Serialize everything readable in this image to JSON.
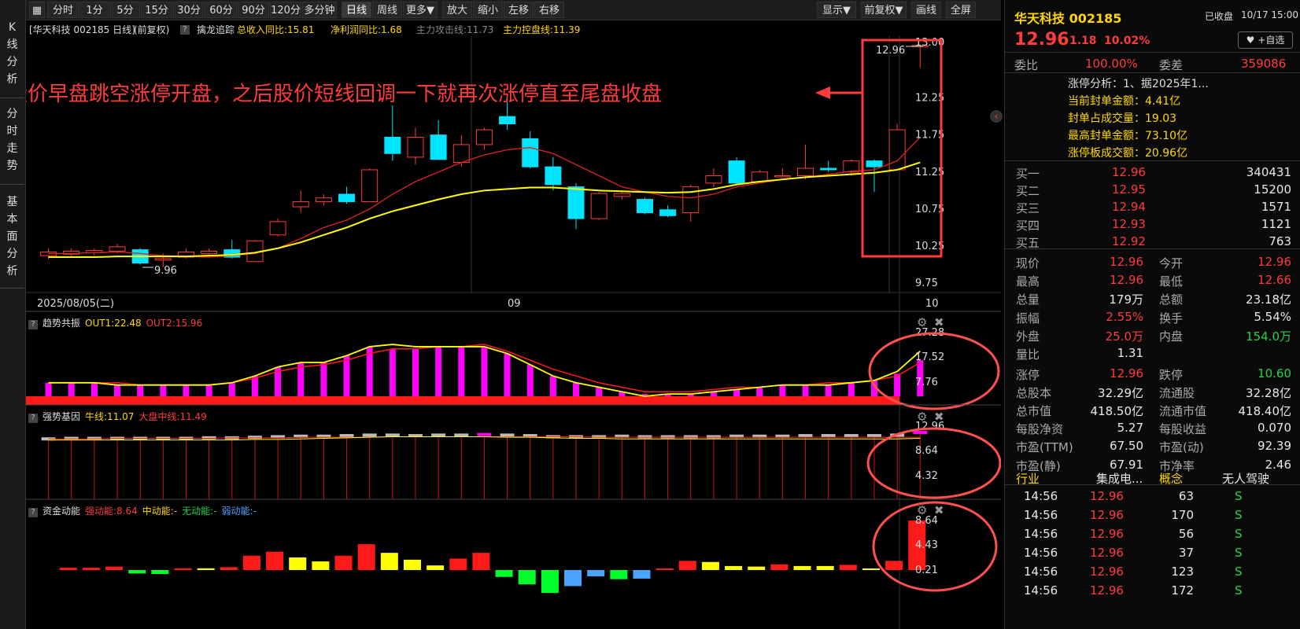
{
  "leftbar": {
    "tabs": [
      "K\n线\n分\n析",
      "分\n时\n走\n势",
      "基\n本\n面\n分\n析"
    ]
  },
  "toolbar": {
    "buttons": [
      "分时",
      "1分",
      "5分",
      "15分",
      "30分",
      "60分",
      "90分",
      "120分",
      "多分钟",
      "日线",
      "周线",
      "更多▼",
      "放大",
      "缩小",
      "左移",
      "右移"
    ],
    "right_buttons": [
      "显示▼",
      "前复权▼",
      "画线",
      "全屏"
    ],
    "active": "日线"
  },
  "infobar": {
    "title": "[华天科技 002185 日线]",
    "adjust": "(前复权)",
    "indicator": "擒龙追踪",
    "revenue": "总收入同比:15.81",
    "profit": "净利润同比:1.68",
    "attack": "主力攻击线:11.73",
    "control": "主力控盘线:11.39"
  },
  "chart": {
    "annotation": "股价早盘跳空涨停开盘，之后股价短线回调一下就再次涨停直至尾盘收盘",
    "high_label": "12.96",
    "low_label": "9.96",
    "date_label": "2025/08/05(二)",
    "month_labels": [
      "09",
      "10"
    ],
    "price_ticks": [
      "13.00",
      "12.25",
      "11.75",
      "11.25",
      "10.75",
      "10.25",
      "9.75"
    ]
  },
  "chart_data": [
    {
      "type": "candlestick",
      "candles": [
        {
          "o": 10.12,
          "h": 10.22,
          "l": 10.07,
          "c": 10.17
        },
        {
          "o": 10.14,
          "h": 10.22,
          "l": 10.1,
          "c": 10.18
        },
        {
          "o": 10.16,
          "h": 10.22,
          "l": 10.12,
          "c": 10.19
        },
        {
          "o": 10.18,
          "h": 10.28,
          "l": 10.15,
          "c": 10.24
        },
        {
          "o": 10.2,
          "h": 10.22,
          "l": 10.0,
          "c": 10.02
        },
        {
          "o": 10.06,
          "h": 10.15,
          "l": 9.96,
          "c": 10.08
        },
        {
          "o": 10.1,
          "h": 10.22,
          "l": 10.08,
          "c": 10.17
        },
        {
          "o": 10.15,
          "h": 10.22,
          "l": 10.12,
          "c": 10.18
        },
        {
          "o": 10.2,
          "h": 10.33,
          "l": 10.08,
          "c": 10.1
        },
        {
          "o": 10.04,
          "h": 10.33,
          "l": 10.04,
          "c": 10.32
        },
        {
          "o": 10.4,
          "h": 10.62,
          "l": 10.38,
          "c": 10.58
        },
        {
          "o": 10.78,
          "h": 11.0,
          "l": 10.7,
          "c": 10.85
        },
        {
          "o": 10.85,
          "h": 10.95,
          "l": 10.8,
          "c": 10.9
        },
        {
          "o": 10.95,
          "h": 11.05,
          "l": 10.82,
          "c": 10.85
        },
        {
          "o": 10.85,
          "h": 11.3,
          "l": 10.85,
          "c": 11.28
        },
        {
          "o": 11.72,
          "h": 12.15,
          "l": 11.4,
          "c": 11.5
        },
        {
          "o": 11.45,
          "h": 11.85,
          "l": 11.35,
          "c": 11.72
        },
        {
          "o": 11.75,
          "h": 11.95,
          "l": 11.42,
          "c": 11.42
        },
        {
          "o": 11.38,
          "h": 11.75,
          "l": 11.32,
          "c": 11.62
        },
        {
          "o": 11.62,
          "h": 11.85,
          "l": 11.55,
          "c": 11.82
        },
        {
          "o": 12.0,
          "h": 12.2,
          "l": 11.82,
          "c": 11.9
        },
        {
          "o": 11.7,
          "h": 11.8,
          "l": 11.3,
          "c": 11.32
        },
        {
          "o": 11.32,
          "h": 11.45,
          "l": 11.0,
          "c": 11.08
        },
        {
          "o": 11.05,
          "h": 11.1,
          "l": 10.48,
          "c": 10.62
        },
        {
          "o": 10.62,
          "h": 10.98,
          "l": 10.6,
          "c": 10.96
        },
        {
          "o": 10.92,
          "h": 11.0,
          "l": 10.88,
          "c": 10.96
        },
        {
          "o": 10.88,
          "h": 10.9,
          "l": 10.68,
          "c": 10.7
        },
        {
          "o": 10.74,
          "h": 10.8,
          "l": 10.64,
          "c": 10.66
        },
        {
          "o": 10.7,
          "h": 11.08,
          "l": 10.58,
          "c": 11.05
        },
        {
          "o": 11.1,
          "h": 11.3,
          "l": 11.05,
          "c": 11.2
        },
        {
          "o": 11.4,
          "h": 11.45,
          "l": 11.08,
          "c": 11.1
        },
        {
          "o": 11.12,
          "h": 11.28,
          "l": 11.1,
          "c": 11.25
        },
        {
          "o": 11.2,
          "h": 11.3,
          "l": 11.18,
          "c": 11.2
        },
        {
          "o": 11.2,
          "h": 11.62,
          "l": 11.15,
          "c": 11.3
        },
        {
          "o": 11.3,
          "h": 11.4,
          "l": 11.25,
          "c": 11.28
        },
        {
          "o": 11.25,
          "h": 11.42,
          "l": 11.2,
          "c": 11.4
        },
        {
          "o": 11.4,
          "h": 11.42,
          "l": 10.98,
          "c": 11.32
        },
        {
          "o": 11.28,
          "h": 11.9,
          "l": 11.28,
          "c": 11.82
        },
        {
          "o": 12.96,
          "h": 12.96,
          "l": 12.66,
          "c": 12.96
        }
      ],
      "ma_short": [
        10.15,
        10.15,
        10.16,
        10.17,
        10.15,
        10.12,
        10.11,
        10.1,
        10.12,
        10.15,
        10.22,
        10.35,
        10.5,
        10.6,
        10.75,
        10.95,
        11.12,
        11.25,
        11.38,
        11.48,
        11.55,
        11.58,
        11.5,
        11.35,
        11.2,
        11.05,
        10.98,
        10.92,
        10.9,
        10.95,
        11.05,
        11.1,
        11.15,
        11.18,
        11.22,
        11.26,
        11.28,
        11.4,
        11.72
      ],
      "ma_long": [
        10.1,
        10.1,
        10.1,
        10.11,
        10.11,
        10.11,
        10.11,
        10.12,
        10.13,
        10.16,
        10.22,
        10.3,
        10.4,
        10.5,
        10.62,
        10.72,
        10.8,
        10.88,
        10.95,
        11.0,
        11.02,
        11.04,
        11.04,
        11.02,
        11.0,
        10.99,
        10.98,
        10.97,
        10.98,
        11.02,
        11.08,
        11.12,
        11.15,
        11.18,
        11.2,
        11.22,
        11.24,
        11.28,
        11.38
      ]
    },
    {
      "type": "bar",
      "name": "趋势共振",
      "labels": [
        "OUT1:22.48",
        "OUT2:15.96"
      ],
      "ticks": [
        "27.28",
        "17.52",
        "7.76"
      ],
      "values": [
        6,
        6,
        6,
        5,
        5,
        5,
        5,
        5,
        6,
        9,
        13,
        15,
        15,
        18,
        22,
        21,
        21,
        22,
        22,
        22,
        19,
        14,
        9,
        6,
        4,
        2,
        1,
        1,
        1,
        2,
        3,
        4,
        5,
        5,
        5,
        6,
        7,
        10,
        16
      ],
      "out1": [
        6,
        6,
        6,
        5,
        5,
        5,
        5,
        5,
        6,
        9,
        13,
        15,
        15,
        18,
        22,
        23,
        22,
        22,
        22,
        22,
        19,
        14,
        9,
        6,
        4,
        2,
        0,
        1,
        1,
        2,
        3,
        4,
        5,
        5,
        5,
        6,
        7,
        11,
        20
      ],
      "out2": [
        6,
        6,
        6,
        6,
        5,
        5,
        5,
        5,
        6,
        8,
        11,
        13,
        14,
        16,
        19,
        21,
        21,
        22,
        22,
        23,
        20,
        16,
        12,
        9,
        6,
        4,
        2,
        2,
        2,
        3,
        4,
        4,
        5,
        5,
        6,
        6,
        7,
        9,
        15
      ]
    },
    {
      "type": "bar",
      "name": "强势基因",
      "labels": [
        "牛线:11.07",
        "大盘中线:11.49"
      ],
      "ticks": [
        "12.96",
        "8.64",
        "4.32"
      ],
      "values": [
        11.2,
        11.3,
        11.3,
        11.3,
        11.3,
        11.3,
        11.3,
        11.4,
        11.4,
        11.5,
        11.6,
        11.7,
        11.7,
        11.8,
        11.9,
        11.9,
        11.8,
        11.9,
        11.9,
        12.0,
        11.9,
        11.8,
        11.6,
        11.6,
        11.6,
        11.7,
        11.6,
        11.6,
        11.6,
        11.6,
        11.7,
        11.7,
        11.7,
        11.8,
        11.8,
        11.8,
        11.8,
        11.9,
        12.4
      ],
      "bull": [
        11.0,
        11.0,
        11.0,
        11.0,
        11.0,
        11.0,
        11.0,
        11.0,
        11.0,
        11.1,
        11.1,
        11.2,
        11.3,
        11.4,
        11.5,
        11.6,
        11.6,
        11.6,
        11.6,
        11.6,
        11.5,
        11.5,
        11.4,
        11.3,
        11.3,
        11.2,
        11.2,
        11.2,
        11.2,
        11.2,
        11.2,
        11.2,
        11.2,
        11.2,
        11.2,
        11.2,
        11.2,
        11.2,
        11.3
      ],
      "market": [
        11.2,
        11.2,
        11.2,
        11.3,
        11.3,
        11.3,
        11.3,
        11.3,
        11.4,
        11.4,
        11.4,
        11.5,
        11.5,
        11.5,
        11.5,
        11.6,
        11.6,
        11.6,
        11.6,
        11.6,
        11.6,
        11.6,
        11.6,
        11.6,
        11.5,
        11.5,
        11.5,
        11.5,
        11.5,
        11.5,
        11.5,
        11.5,
        11.5,
        11.5,
        11.5,
        11.5,
        11.5,
        11.5,
        11.5
      ]
    },
    {
      "type": "bar",
      "name": "资金动能",
      "labels": [
        "强动能:8.64",
        "中动能:-",
        "无动能:-",
        "弱动能:-"
      ],
      "ticks": [
        "8.64",
        "4.43",
        "0.21"
      ],
      "values": [
        0.4,
        0.4,
        0.6,
        -0.6,
        -0.7,
        0.3,
        0.3,
        0.5,
        2.5,
        3.2,
        2.2,
        1.5,
        2.5,
        4.5,
        3.0,
        1.8,
        0.8,
        2.0,
        3.0,
        -1.2,
        -2.5,
        -4.0,
        -2.8,
        -1.1,
        -1.6,
        -1.5,
        0.1,
        1.6,
        1.4,
        0.7,
        0.6,
        1.0,
        0.7,
        0.7,
        0.9,
        0.1,
        1.6,
        8.64
      ],
      "colors": [
        "r",
        "r",
        "r",
        "g",
        "g",
        "r",
        "y",
        "r",
        "r",
        "r",
        "y",
        "y",
        "r",
        "r",
        "y",
        "y",
        "y",
        "r",
        "r",
        "g",
        "g",
        "g",
        "b",
        "b",
        "g",
        "b",
        "r",
        "r",
        "y",
        "y",
        "y",
        "r",
        "y",
        "y",
        "r",
        "y",
        "r",
        "r"
      ]
    }
  ],
  "panels": {
    "trend": {
      "name": "趋势共振",
      "out1": "OUT1:22.48",
      "out2": "OUT2:15.96"
    },
    "gene": {
      "name": "强势基因",
      "bull": "牛线:11.07",
      "market": "大盘中线:11.49"
    },
    "money": {
      "name": "资金动能",
      "strong": "强动能:8.64",
      "mid": "中动能:-",
      "none": "无动能:-",
      "weak": "弱动能:-"
    }
  },
  "quote": {
    "name": "华天科技 002185",
    "status": "已收盘",
    "time": "10/17 15:00",
    "price": "12.96",
    "change": "1.18",
    "pct": "10.02%",
    "watch": "+自选",
    "weibi_label": "委比",
    "weibi": "100.00%",
    "weicha_label": "委差",
    "weicha": "359086",
    "limit_analysis": [
      "涨停分析：1、据2025年1...",
      "当前封单金额：4.41亿",
      "封单占成交量：19.03",
      "最高封单金额：73.10亿",
      "涨停板成交额：20.96亿"
    ],
    "bids": [
      {
        "label": "买一",
        "price": "12.96",
        "vol": "340431"
      },
      {
        "label": "买二",
        "price": "12.95",
        "vol": "15200"
      },
      {
        "label": "买三",
        "price": "12.94",
        "vol": "1571"
      },
      {
        "label": "买四",
        "price": "12.93",
        "vol": "1121"
      },
      {
        "label": "买五",
        "price": "12.92",
        "vol": "763"
      }
    ],
    "stats": [
      [
        {
          "l": "现价",
          "v": "12.96",
          "c": "red"
        },
        {
          "l": "今开",
          "v": "12.96",
          "c": "red"
        }
      ],
      [
        {
          "l": "最高",
          "v": "12.96",
          "c": "red"
        },
        {
          "l": "最低",
          "v": "12.66",
          "c": "red"
        }
      ],
      [
        {
          "l": "总量",
          "v": "179万",
          "c": "white"
        },
        {
          "l": "总额",
          "v": "23.18亿",
          "c": "white"
        }
      ],
      [
        {
          "l": "振幅",
          "v": "2.55%",
          "c": "red"
        },
        {
          "l": "换手",
          "v": "5.54%",
          "c": "white"
        }
      ],
      [
        {
          "l": "外盘",
          "v": "25.0万",
          "c": "red"
        },
        {
          "l": "内盘",
          "v": "154.0万",
          "c": "green"
        }
      ],
      [
        {
          "l": "量比",
          "v": "1.31",
          "c": "white"
        },
        {
          "l": "",
          "v": "",
          "c": "white"
        }
      ],
      [
        {
          "l": "涨停",
          "v": "12.96",
          "c": "red"
        },
        {
          "l": "跌停",
          "v": "10.60",
          "c": "green"
        }
      ],
      [
        {
          "l": "总股本",
          "v": "32.29亿",
          "c": "white"
        },
        {
          "l": "流通股",
          "v": "32.28亿",
          "c": "white"
        }
      ],
      [
        {
          "l": "总市值",
          "v": "418.50亿",
          "c": "white"
        },
        {
          "l": "流通市值",
          "v": "418.40亿",
          "c": "white"
        }
      ],
      [
        {
          "l": "每股净资",
          "v": "5.27",
          "c": "white"
        },
        {
          "l": "每股收益",
          "v": "0.070",
          "c": "white"
        }
      ],
      [
        {
          "l": "市盈(TTM)",
          "v": "67.50",
          "c": "white"
        },
        {
          "l": "市盈(动)",
          "v": "92.39",
          "c": "white"
        }
      ],
      [
        {
          "l": "市盈(静)",
          "v": "67.91",
          "c": "white"
        },
        {
          "l": "市净率",
          "v": "2.46",
          "c": "white"
        }
      ]
    ],
    "industry_label": "行业",
    "industry": "集成电...",
    "concept_label": "概念",
    "concept": "无人驾驶",
    "ticks": [
      {
        "t": "14:56",
        "p": "12.96",
        "v": "63",
        "s": "S"
      },
      {
        "t": "14:56",
        "p": "12.96",
        "v": "170",
        "s": "S"
      },
      {
        "t": "14:56",
        "p": "12.96",
        "v": "56",
        "s": "S"
      },
      {
        "t": "14:56",
        "p": "12.96",
        "v": "37",
        "s": "S"
      },
      {
        "t": "14:56",
        "p": "12.96",
        "v": "123",
        "s": "S"
      },
      {
        "t": "14:56",
        "p": "12.96",
        "v": "172",
        "s": "S"
      }
    ]
  },
  "colors": {
    "up": "#ff3b3b",
    "down": "#00e5ff",
    "ma_long": "#ffff00",
    "ma_short": "#e02020",
    "magenta": "#ff00ff",
    "annotation": "#ff3b3b"
  }
}
